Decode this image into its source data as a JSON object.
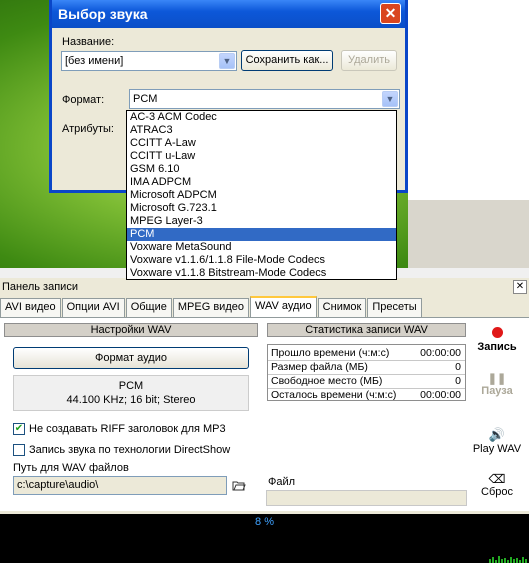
{
  "dialog": {
    "title": "Выбор звука",
    "name_label": "Название:",
    "name_value": "[без имени]",
    "save_as_label": "Сохранить как...",
    "delete_label": "Удалить",
    "format_label": "Формат:",
    "format_value": "PCM",
    "attributes_label": "Атрибуты:",
    "close_glyph": "✕",
    "format_options": [
      "AC-3 ACM Codec",
      "ATRAC3",
      "CCITT A-Law",
      "CCITT u-Law",
      "GSM 6.10",
      "IMA ADPCM",
      "Microsoft ADPCM",
      "Microsoft G.723.1",
      "MPEG Layer-3",
      "PCM",
      "Voxware MetaSound",
      "Voxware v1.1.6/1.1.8 File-Mode Codecs",
      "Voxware v1.1.8 Bitstream-Mode Codecs"
    ],
    "selected_option": "PCM"
  },
  "panel": {
    "title": "Панель записи",
    "close_glyph": "✕",
    "tabs": [
      "AVI видео",
      "Опции AVI",
      "Общие",
      "MPEG видео",
      "WAV аудио",
      "Снимок",
      "Пресеты"
    ],
    "active_tab": "WAV аудио",
    "wav_settings": {
      "header": "Настройки WAV",
      "format_button": "Формат аудио",
      "format_name": "PCM",
      "format_details": "44.100 KHz; 16 bit; Stereo",
      "riff_checkbox_label": "Не создавать RIFF заголовок для MP3",
      "riff_checked": true,
      "directshow_checkbox_label": "Запись звука по технологии DirectShow",
      "directshow_checked": false,
      "path_label": "Путь для WAV файлов",
      "path_value": "c:\\capture\\audio\\"
    },
    "stats": {
      "header": "Статистика записи WAV",
      "rows": [
        {
          "label": "Прошло времени (ч:м:с)",
          "value": "00:00:00"
        },
        {
          "label": "Размер файла (МБ)",
          "value": "0"
        },
        {
          "label": "Свободное место (МБ)",
          "value": "0"
        },
        {
          "label": "Осталось времени (ч:м:с)",
          "value": "00:00:00"
        }
      ],
      "file_label": "Файл",
      "file_value": ""
    },
    "side_buttons": {
      "record": "Запись",
      "pause": "Пауза",
      "play": "Play WAV",
      "reset": "Сброс"
    },
    "progress_text": "8 %"
  },
  "colors": {
    "accent_blue": "#0a4ec8",
    "record_red": "#e01818",
    "progress_text": "#3fa2ff",
    "selection": "#316ac5"
  }
}
